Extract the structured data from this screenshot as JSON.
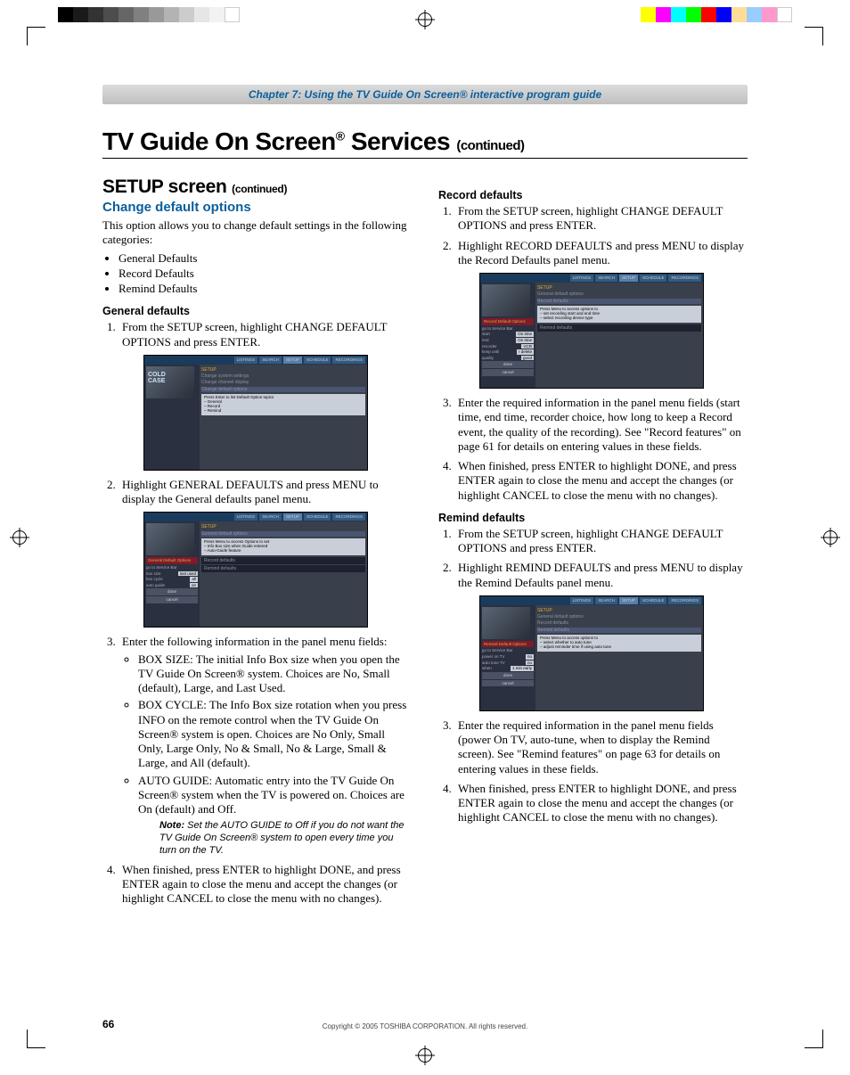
{
  "chapter_bar": "Chapter 7: Using the TV Guide On Screen® interactive program guide",
  "h1_pre": "TV Guide On Screen",
  "h1_sup": "®",
  "h1_post": " Services ",
  "h1_cont": "(continued)",
  "h2_pre": "SETUP screen ",
  "h2_cont": "(continued)",
  "h3_change": "Change default options",
  "intro": "This option allows you to change default settings in the following categories:",
  "cat1": "General Defaults",
  "cat2": "Record Defaults",
  "cat3": "Remind Defaults",
  "h4_general": "General defaults",
  "gen_step1": "From the SETUP screen, highlight CHANGE DEFAULT OPTIONS and press ENTER.",
  "gen_step2": "Highlight GENERAL DEFAULTS and press MENU to display the General defaults panel menu.",
  "gen_step3": "Enter the following information in the panel menu fields:",
  "gen_box_size": "BOX SIZE: The initial Info Box size when you open the TV Guide On Screen® system. Choices are No, Small (default), Large, and Last Used.",
  "gen_box_cycle": "BOX CYCLE: The Info Box size rotation when you press INFO on the remote control when the TV Guide On Screen® system is open. Choices are No Only, Small Only, Large Only, No & Small, No & Large, Small & Large, and All (default).",
  "gen_auto_guide": "AUTO GUIDE: Automatic entry into the TV Guide On Screen® system when the TV is powered on. Choices are On (default) and Off.",
  "note_label": "Note:",
  "note_text": " Set the AUTO GUIDE to Off if you do not want the TV Guide On Screen® system to open every time you turn on the TV.",
  "gen_step4": "When finished, press ENTER to highlight DONE, and press ENTER again to close the menu and accept the changes (or highlight CANCEL to close the menu with no changes).",
  "h4_record": "Record defaults",
  "rec_step1": "From the SETUP screen, highlight CHANGE DEFAULT OPTIONS and press ENTER.",
  "rec_step2": "Highlight RECORD DEFAULTS and press MENU to display the Record Defaults panel menu.",
  "rec_step3": "Enter the required information in the panel menu fields (start time, end time, recorder choice, how long to keep a Record event, the quality of the recording). See \"Record features\" on page 61 for details on entering values in these fields.",
  "rec_step4": "When finished, press ENTER to highlight DONE, and press ENTER again to close the menu and accept the changes (or highlight CANCEL to close the menu with no changes).",
  "h4_remind": "Remind defaults",
  "rem_step1": "From the SETUP screen, highlight CHANGE DEFAULT OPTIONS and press ENTER.",
  "rem_step2": "Highlight REMIND DEFAULTS and press MENU to display the Remind Defaults panel menu.",
  "rem_step3": "Enter the required information in the panel menu fields (power On TV, auto-tune, when to display the Remind screen). See \"Remind features\" on page 63 for details on entering values in these fields.",
  "rem_step4": "When finished, press ENTER to highlight DONE, and press ENTER again to close the menu and accept the changes (or highlight CANCEL to close the menu with no changes).",
  "copyright": "Copyright © 2005 TOSHIBA CORPORATION. All rights reserved.",
  "page_num": "66",
  "tabs": {
    "listings": "LISTINGS",
    "search": "SEARCH",
    "setup": "SETUP",
    "schedule": "SCHEDULE",
    "recordings": "RECORDINGS"
  },
  "ss1": {
    "crumbs": [
      "SETUP",
      "Change system settings",
      "Change channel display",
      "Change default options"
    ],
    "hint": "Press Enter to list Default Option topics\n– General\n– Record\n– Remind"
  },
  "ss2": {
    "crumbs": [
      "SETUP",
      "General default options"
    ],
    "hint": "Press Menu to access Options to set\n– Info Box size when Guide entered\n– Auto-Guide feature",
    "panel_label": "General Default Options",
    "goto": "go to Service Bar",
    "rows": [
      [
        "box size",
        "last used"
      ],
      [
        "box cycle",
        "all"
      ],
      [
        "auto guide",
        "on"
      ]
    ],
    "btns": [
      "done",
      "cancel"
    ],
    "sections": [
      "Record defaults",
      "Remind defaults"
    ]
  },
  "ss3": {
    "crumbs": [
      "SETUP",
      "General default options",
      "Record defaults"
    ],
    "hint": "Press Menu to access options to\n– set recording start and end time\n– select recording device type",
    "panel_label": "Record Default Options",
    "goto": "go to Service Bar",
    "rows": [
      [
        "start",
        "On time"
      ],
      [
        "end",
        "On time"
      ],
      [
        "recorder",
        "VCR"
      ],
      [
        "keep until",
        "I delete"
      ],
      [
        "quality",
        "good"
      ]
    ],
    "btns": [
      "done",
      "cancel"
    ],
    "sections": [
      "Remind defaults"
    ]
  },
  "ss4": {
    "crumbs": [
      "SETUP",
      "General default options",
      "Record defaults",
      "Remind defaults"
    ],
    "hint": "Press Menu to access options to\n– select whether to auto tune\n– adjust reminder time if using auto tune",
    "panel_label": "Remind Default Options",
    "goto": "go to Service Bar",
    "rows": [
      [
        "power on TV",
        "no"
      ],
      [
        "auto tune TV",
        "no"
      ],
      [
        "when",
        "1 min early"
      ]
    ],
    "btns": [
      "done",
      "cancel"
    ]
  }
}
